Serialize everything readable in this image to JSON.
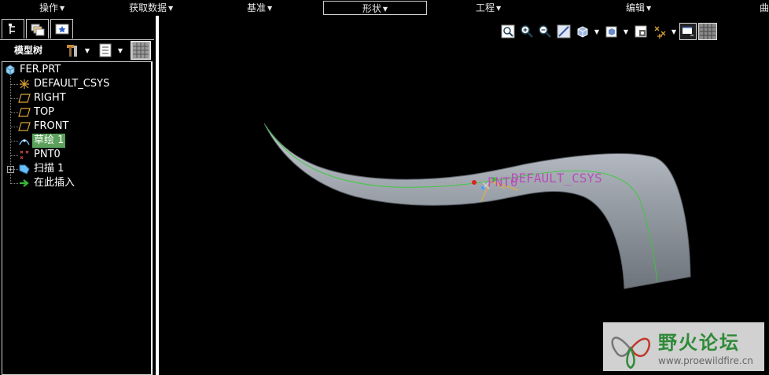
{
  "menu": {
    "items": [
      {
        "label": "操作"
      },
      {
        "label": "获取数据"
      },
      {
        "label": "基准"
      },
      {
        "label": "形状"
      },
      {
        "label": "工程"
      },
      {
        "label": "编辑"
      },
      {
        "label": "曲"
      }
    ],
    "active_index": 3
  },
  "model_tree": {
    "title": "模型树",
    "items": [
      {
        "label": "FER.PRT",
        "icon": "part-icon"
      },
      {
        "label": "DEFAULT_CSYS",
        "icon": "csys-icon"
      },
      {
        "label": "RIGHT",
        "icon": "datum-plane-icon"
      },
      {
        "label": "TOP",
        "icon": "datum-plane-icon"
      },
      {
        "label": "FRONT",
        "icon": "datum-plane-icon"
      },
      {
        "label": "草绘 1",
        "icon": "sketch-icon",
        "selected": true
      },
      {
        "label": "PNT0",
        "icon": "datum-point-icon"
      },
      {
        "label": "扫描 1",
        "icon": "sweep-icon"
      },
      {
        "label": "在此插入",
        "icon": "insert-here-arrow-icon"
      }
    ]
  },
  "viewport": {
    "labels": {
      "csys": "DEFAULT_CSYS",
      "point": "PNT0"
    },
    "colors": {
      "background": "#000000",
      "surface": "#9aa0a8",
      "sketch_curve": "#33cc33",
      "annotation": "#b84db8"
    }
  },
  "watermark": {
    "title": "野火论坛",
    "url": "www.proewildfire.cn"
  }
}
